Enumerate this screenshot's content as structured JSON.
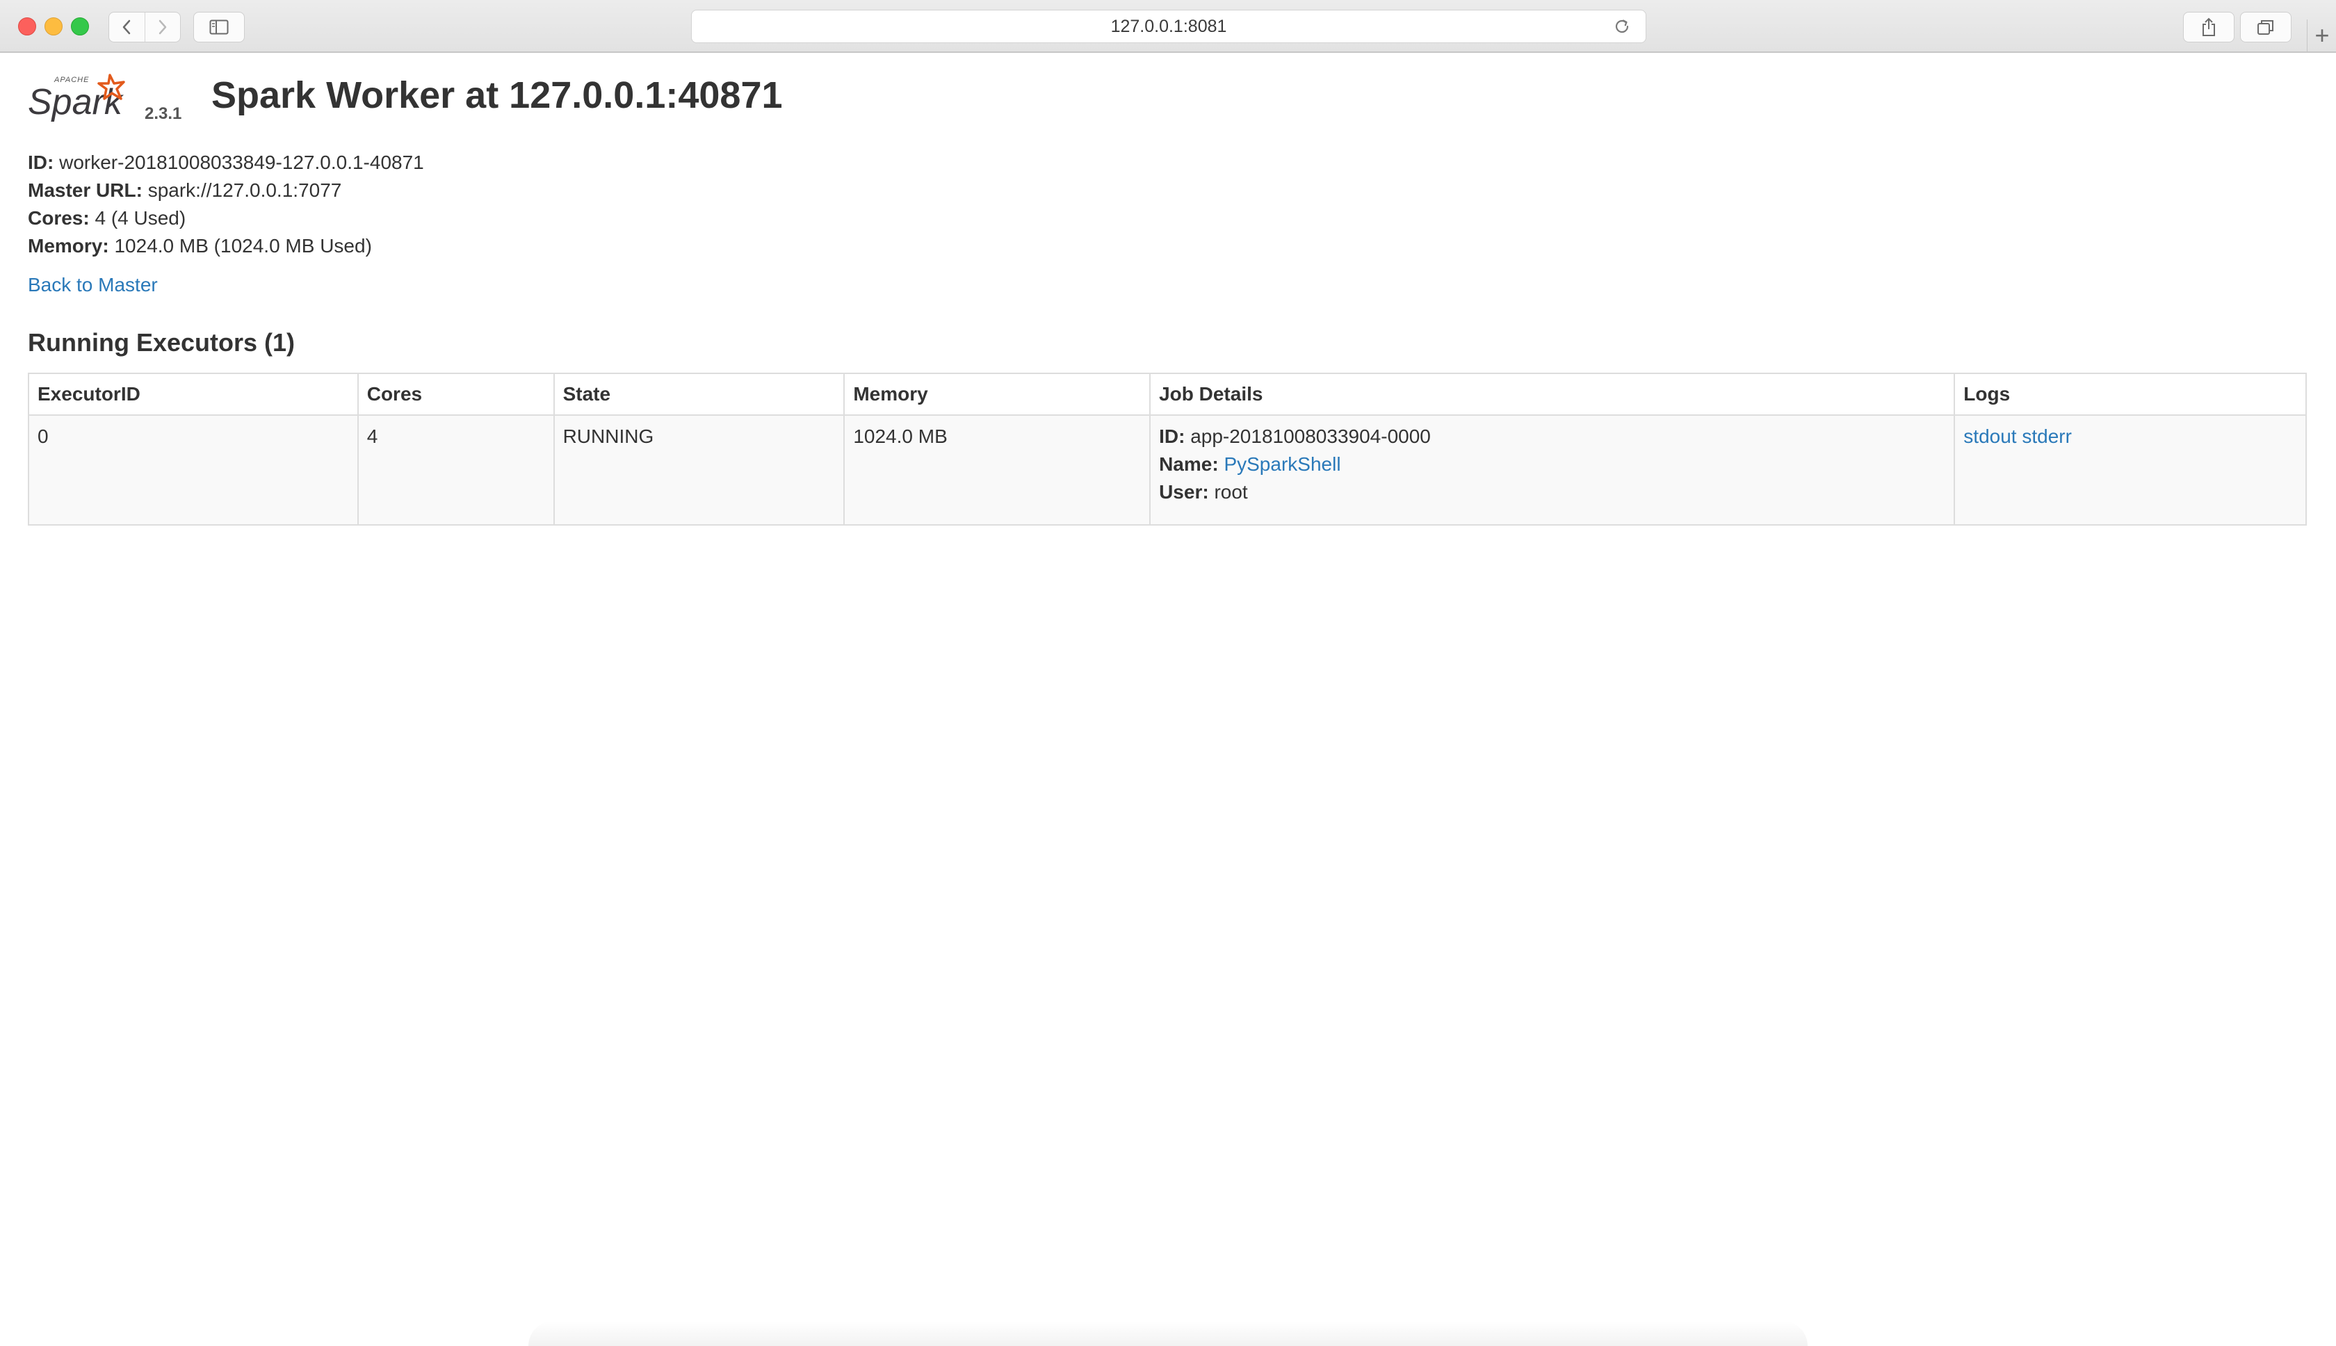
{
  "browser": {
    "url": "127.0.0.1:8081"
  },
  "header": {
    "logo_text": "Spark",
    "logo_small": "APACHE",
    "version": "2.3.1",
    "title": "Spark Worker at 127.0.0.1:40871"
  },
  "info": {
    "id_label": "ID:",
    "id_value": "worker-20181008033849-127.0.0.1-40871",
    "master_label": "Master URL:",
    "master_value": "spark://127.0.0.1:7077",
    "cores_label": "Cores:",
    "cores_value": "4 (4 Used)",
    "memory_label": "Memory:",
    "memory_value": "1024.0 MB (1024.0 MB Used)"
  },
  "back_link": "Back to Master",
  "section_title": "Running Executors (1)",
  "table": {
    "headers": [
      "ExecutorID",
      "Cores",
      "State",
      "Memory",
      "Job Details",
      "Logs"
    ],
    "rows": [
      {
        "executor_id": "0",
        "cores": "4",
        "state": "RUNNING",
        "memory": "1024.0 MB",
        "job_id_label": "ID:",
        "job_id": "app-20181008033904-0000",
        "job_name_label": "Name:",
        "job_name": "PySparkShell",
        "job_user_label": "User:",
        "job_user": "root",
        "log_stdout": "stdout",
        "log_stderr": "stderr"
      }
    ]
  },
  "colors": {
    "link": "#2a79b9",
    "spark_orange": "#e25a1c",
    "text": "#333333"
  }
}
